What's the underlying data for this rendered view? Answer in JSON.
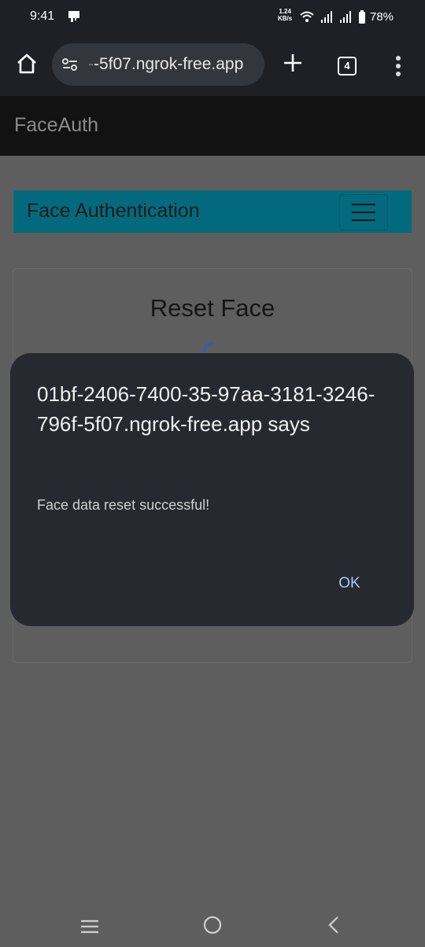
{
  "status": {
    "time": "9:41",
    "net_speed_value": "1.24",
    "net_speed_unit": "KB/s",
    "battery": "78%"
  },
  "browser": {
    "url_prefix": "-",
    "url": "-5f07.ngrok-free.app",
    "tab_count": "4"
  },
  "app": {
    "brand": "FaceAuth",
    "nav_title": "Face Authentication",
    "card_title": "Reset Face"
  },
  "dialog": {
    "origin": "01bf-2406-7400-35-97aa-3181-3246-796f-5f07.ngrok-free.app says",
    "message": "Face data reset successful!",
    "ok_label": "OK"
  },
  "colors": {
    "navbar": "#036a7e",
    "dialog_bg": "#272930",
    "ok_text": "#aac7ff",
    "spinner": "#2a5fc4"
  },
  "icons": [
    "home-icon",
    "tune-icon",
    "plus-icon",
    "tab-switcher-icon",
    "more-vert-icon",
    "hamburger-icon",
    "recents-icon",
    "home-circle-icon",
    "back-icon"
  ]
}
